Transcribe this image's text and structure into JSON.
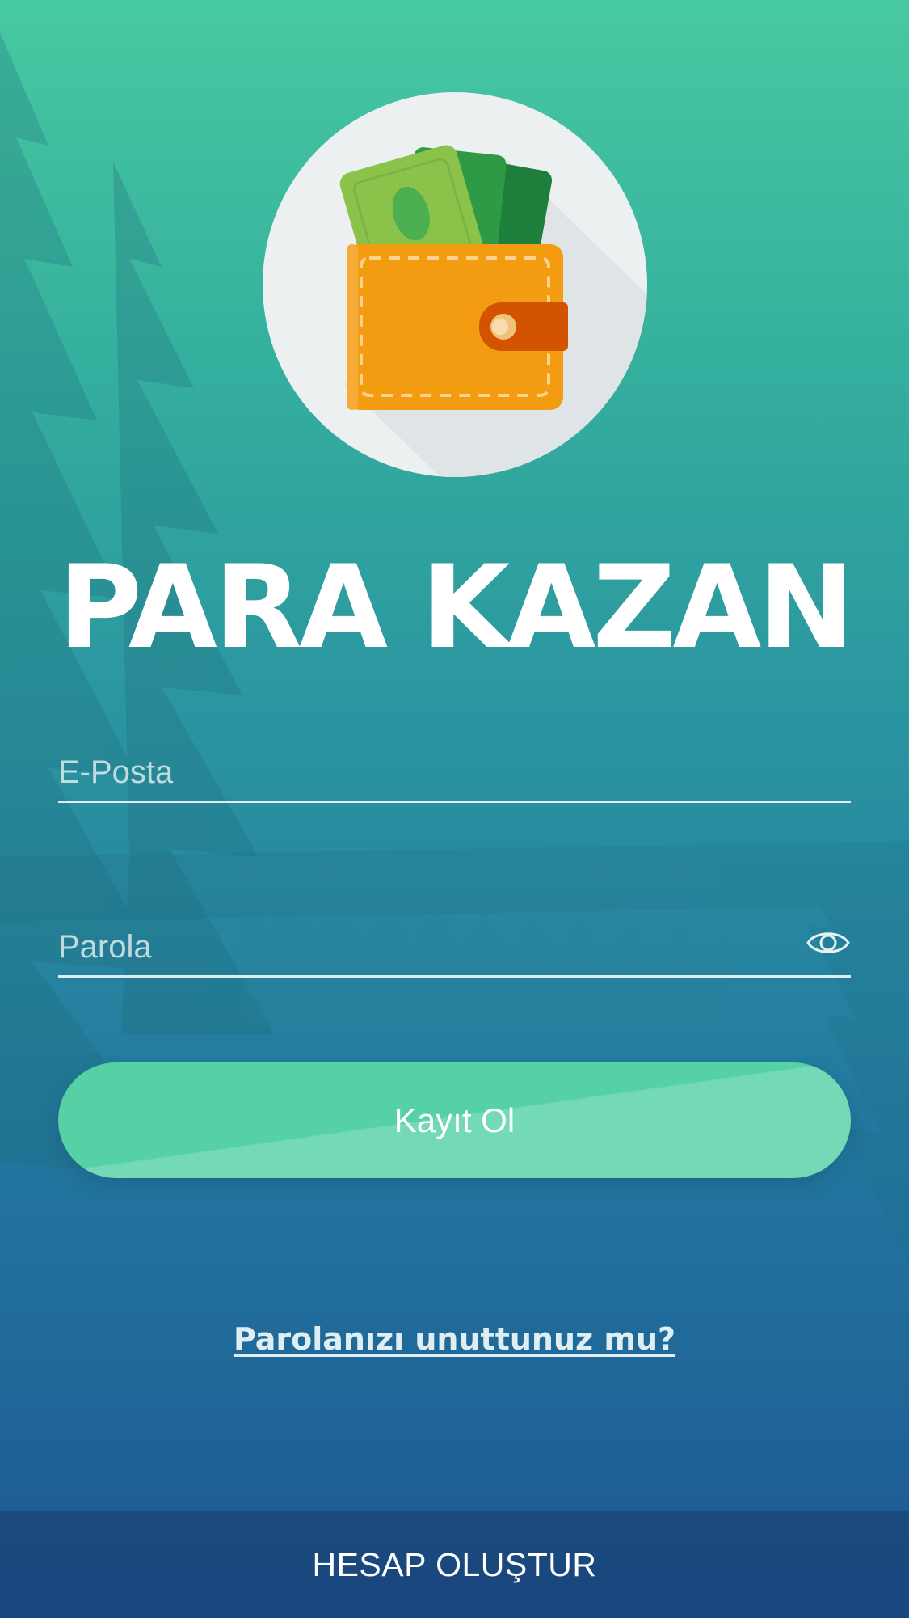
{
  "app": {
    "title": "PARA KAZAN",
    "logo_icon": "wallet-icon"
  },
  "form": {
    "email_placeholder": "E-Posta",
    "email_value": "",
    "password_placeholder": "Parola",
    "password_value": "",
    "password_toggle_icon": "eye-icon",
    "submit_label": "Kayıt Ol",
    "forgot_label": "Parolanızı unuttunuz mu?"
  },
  "footer": {
    "create_account_label": "HESAP OLUŞTUR"
  },
  "colors": {
    "gradient_top": "#47c9a0",
    "gradient_bottom": "#1c5794",
    "button": "#56d1a6",
    "wallet": "#f39c12",
    "cash": "#8bc34a"
  }
}
